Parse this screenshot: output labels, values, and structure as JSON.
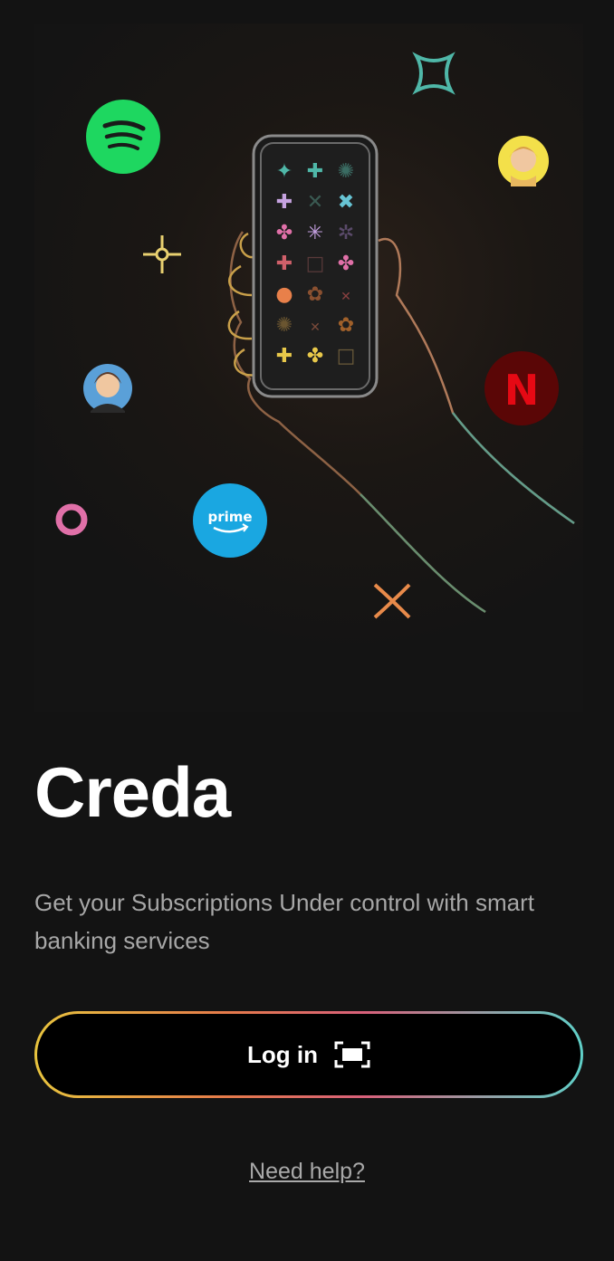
{
  "app": {
    "name": "Creda",
    "tagline": "Get your Subscriptions Under control with smart banking services"
  },
  "hero": {
    "services": [
      "spotify-icon",
      "netflix-icon",
      "prime-video-icon"
    ],
    "prime_text": "prime",
    "netflix_letter": "N"
  },
  "login": {
    "label": "Log in",
    "icon": "face-id-icon"
  },
  "help": {
    "label": "Need help?"
  },
  "colors": {
    "background": "#131313",
    "spotify": "#1ED760",
    "netflix": "#5a0606",
    "prime": "#1AA7E1",
    "gradient_start": "#e8c43e",
    "gradient_end": "#5fd0c8"
  }
}
